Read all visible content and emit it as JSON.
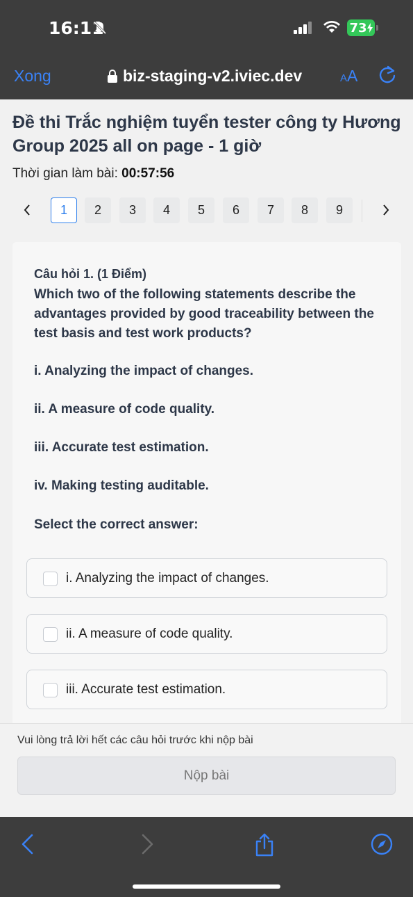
{
  "status_bar": {
    "time": "16:11",
    "battery": "73"
  },
  "browser": {
    "done_label": "Xong",
    "url": "biz-staging-v2.iviec.dev",
    "text_size_label_small": "A",
    "text_size_label_large": "A"
  },
  "exam": {
    "title": "Đề thi Trắc nghiệm tuyển tester công ty Hương Group 2025 all on page - 1 giờ",
    "timer_label": "Thời gian làm bài:",
    "timer_value": "00:57:56",
    "pages": [
      "1",
      "2",
      "3",
      "4",
      "5",
      "6",
      "7",
      "8",
      "9"
    ],
    "active_page": "1"
  },
  "question": {
    "header": "Câu hỏi 1. (1 Điểm)",
    "text": "Which two of the following statements describe the advantages provided by good traceability between the test basis and test work products?",
    "statements": [
      "i. Analyzing the impact of changes.",
      "ii. A measure of code quality.",
      "iii. Accurate test estimation.",
      "iv. Making testing auditable."
    ],
    "prompt": "Select the correct answer:",
    "options": [
      "i. Analyzing the impact of changes.",
      "ii. A measure of code quality.",
      "iii. Accurate test estimation."
    ]
  },
  "footer": {
    "note": "Vui lòng trả lời hết các câu hỏi trước khi nộp bài",
    "submit_label": "Nộp bài"
  },
  "colors": {
    "accent": "#3a82f7",
    "active_page": "#2f80ed",
    "battery": "#34c759",
    "chrome": "#3d3d3d"
  }
}
